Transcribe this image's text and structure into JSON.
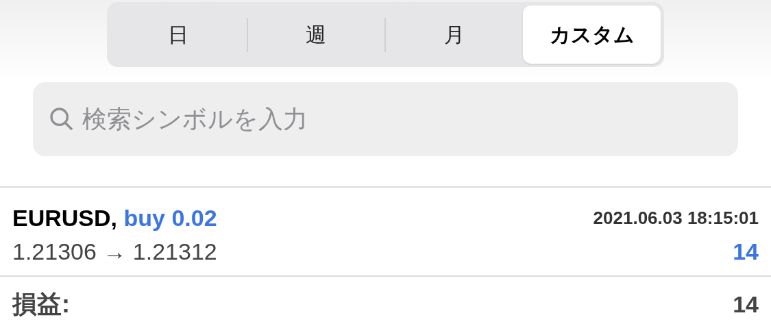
{
  "periods": [
    {
      "label": "日",
      "selected": false
    },
    {
      "label": "週",
      "selected": false
    },
    {
      "label": "月",
      "selected": false
    },
    {
      "label": "カスタム",
      "selected": true
    }
  ],
  "search": {
    "placeholder": "検索シンボルを入力"
  },
  "trades": [
    {
      "symbol": "EURUSD,",
      "side": "buy 0.02",
      "time": "2021.06.03 18:15:01",
      "prices": "1.21306 → 1.21312",
      "profit": "14"
    }
  ],
  "summary": {
    "label": "損益:",
    "value": "14"
  }
}
